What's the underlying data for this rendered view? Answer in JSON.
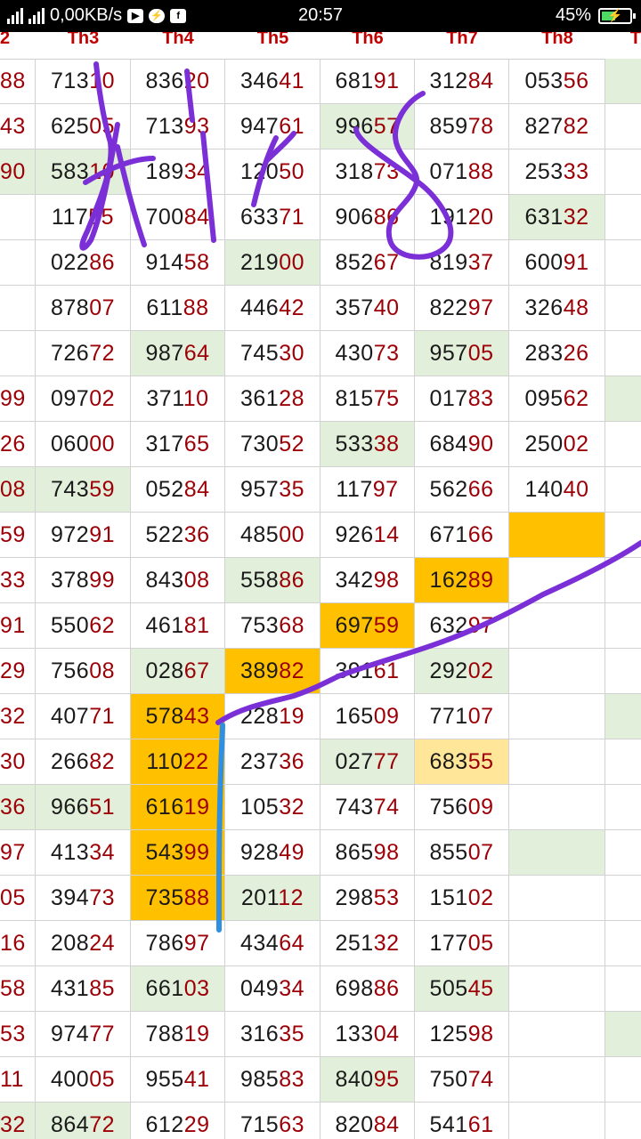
{
  "status_bar": {
    "network": "0,00KB/s",
    "time": "20:57",
    "battery": "45%",
    "icons": [
      "signal-icon",
      "signal-icon",
      "youtube-icon",
      "messenger-icon",
      "facebook-icon",
      "battery-charging-icon"
    ]
  },
  "columns": [
    "2",
    "Th3",
    "Th4",
    "Th5",
    "Th6",
    "Th7",
    "Th8",
    "Th"
  ],
  "rows": [
    {
      "cells": [
        "88",
        "71310",
        "83620",
        "34641",
        "68191",
        "31284",
        "05356",
        ""
      ],
      "hl": [
        "",
        "",
        "",
        "",
        "",
        "",
        "",
        "g"
      ]
    },
    {
      "cells": [
        "43",
        "62505",
        "71393",
        "94761",
        "99657",
        "85978",
        "82782",
        ""
      ],
      "hl": [
        "",
        "",
        "",
        "",
        "g",
        "",
        "",
        ""
      ]
    },
    {
      "cells": [
        "90",
        "58310",
        "18934",
        "12050",
        "31873",
        "07188",
        "25333",
        ""
      ],
      "hl": [
        "g",
        "g",
        "",
        "",
        "",
        "",
        "",
        ""
      ]
    },
    {
      "cells": [
        "",
        "11755",
        "70084",
        "63371",
        "90686",
        "19120",
        "63132",
        ""
      ],
      "hl": [
        "",
        "",
        "",
        "",
        "",
        "",
        "g",
        ""
      ]
    },
    {
      "cells": [
        "",
        "02286",
        "91458",
        "21900",
        "85267",
        "81937",
        "60091",
        ""
      ],
      "hl": [
        "",
        "",
        "",
        "g",
        "",
        "",
        "",
        ""
      ]
    },
    {
      "cells": [
        "",
        "87807",
        "61188",
        "44642",
        "35740",
        "82297",
        "32648",
        ""
      ],
      "hl": [
        "",
        "",
        "",
        "",
        "",
        "",
        "",
        ""
      ]
    },
    {
      "cells": [
        "",
        "72672",
        "98764",
        "74530",
        "43073",
        "95705",
        "28326",
        ""
      ],
      "hl": [
        "",
        "",
        "g",
        "",
        "",
        "g",
        "",
        ""
      ]
    },
    {
      "cells": [
        "99",
        "09702",
        "37110",
        "36128",
        "81575",
        "01783",
        "09562",
        ""
      ],
      "hl": [
        "",
        "",
        "",
        "",
        "",
        "",
        "",
        "g"
      ]
    },
    {
      "cells": [
        "26",
        "06000",
        "31765",
        "73052",
        "53338",
        "68490",
        "25002",
        ""
      ],
      "hl": [
        "",
        "",
        "",
        "",
        "g",
        "",
        "",
        ""
      ]
    },
    {
      "cells": [
        "08",
        "74359",
        "05284",
        "95735",
        "11797",
        "56266",
        "14040",
        ""
      ],
      "hl": [
        "g",
        "g",
        "",
        "",
        "",
        "",
        "",
        ""
      ]
    },
    {
      "cells": [
        "59",
        "97291",
        "52236",
        "48500",
        "92614",
        "67166",
        "",
        ""
      ],
      "hl": [
        "",
        "",
        "",
        "",
        "",
        "",
        "o",
        ""
      ]
    },
    {
      "cells": [
        "33",
        "37899",
        "84308",
        "55886",
        "34298",
        "16289",
        "",
        ""
      ],
      "hl": [
        "",
        "",
        "",
        "g",
        "",
        "o",
        "",
        ""
      ]
    },
    {
      "cells": [
        "91",
        "55062",
        "46181",
        "75368",
        "69759",
        "63297",
        "",
        ""
      ],
      "hl": [
        "",
        "",
        "",
        "",
        "o",
        "",
        "",
        ""
      ]
    },
    {
      "cells": [
        "29",
        "75608",
        "02867",
        "38982",
        "39161",
        "29202",
        "",
        ""
      ],
      "hl": [
        "",
        "",
        "g",
        "o",
        "",
        "g",
        "",
        ""
      ]
    },
    {
      "cells": [
        "32",
        "40771",
        "57843",
        "22819",
        "16509",
        "77107",
        "",
        ""
      ],
      "hl": [
        "",
        "",
        "o",
        "",
        "",
        "",
        "",
        "g"
      ]
    },
    {
      "cells": [
        "30",
        "26682",
        "11022",
        "23736",
        "02777",
        "68355",
        "",
        ""
      ],
      "hl": [
        "",
        "",
        "o",
        "",
        "g",
        "y",
        "",
        ""
      ]
    },
    {
      "cells": [
        "36",
        "96651",
        "61619",
        "10532",
        "74374",
        "75609",
        "",
        ""
      ],
      "hl": [
        "g",
        "g",
        "o",
        "",
        "",
        "",
        "",
        ""
      ]
    },
    {
      "cells": [
        "97",
        "41334",
        "54399",
        "92849",
        "86598",
        "85507",
        "",
        ""
      ],
      "hl": [
        "",
        "",
        "o",
        "",
        "",
        "",
        "g",
        ""
      ]
    },
    {
      "cells": [
        "05",
        "39473",
        "73588",
        "20112",
        "29853",
        "15102",
        "",
        ""
      ],
      "hl": [
        "",
        "",
        "o",
        "g",
        "",
        "",
        "",
        ""
      ]
    },
    {
      "cells": [
        "16",
        "20824",
        "78697",
        "43464",
        "25132",
        "17705",
        "",
        ""
      ],
      "hl": [
        "",
        "",
        "",
        "",
        "",
        "",
        "",
        ""
      ]
    },
    {
      "cells": [
        "58",
        "43185",
        "66103",
        "04934",
        "69886",
        "50545",
        "",
        ""
      ],
      "hl": [
        "",
        "",
        "g",
        "",
        "",
        "g",
        "",
        ""
      ]
    },
    {
      "cells": [
        "53",
        "97477",
        "78819",
        "31635",
        "13304",
        "12598",
        "",
        ""
      ],
      "hl": [
        "",
        "",
        "",
        "",
        "",
        "",
        "",
        "g"
      ]
    },
    {
      "cells": [
        "11",
        "40005",
        "95541",
        "98583",
        "84095",
        "75074",
        "",
        ""
      ],
      "hl": [
        "",
        "",
        "",
        "",
        "g",
        "",
        "",
        ""
      ]
    },
    {
      "cells": [
        "32",
        "86472",
        "61229",
        "71563",
        "82084",
        "54161",
        "",
        ""
      ],
      "hl": [
        "g",
        "g",
        "",
        "",
        "",
        "",
        "",
        ""
      ]
    }
  ],
  "colors": {
    "accent_red": "#9c0006",
    "highlight_green": "#e2efda",
    "highlight_orange": "#ffc000",
    "highlight_light_yellow": "#ffe699",
    "ink_purple": "#7b2fd6",
    "ink_blue": "#2f8fe0"
  }
}
